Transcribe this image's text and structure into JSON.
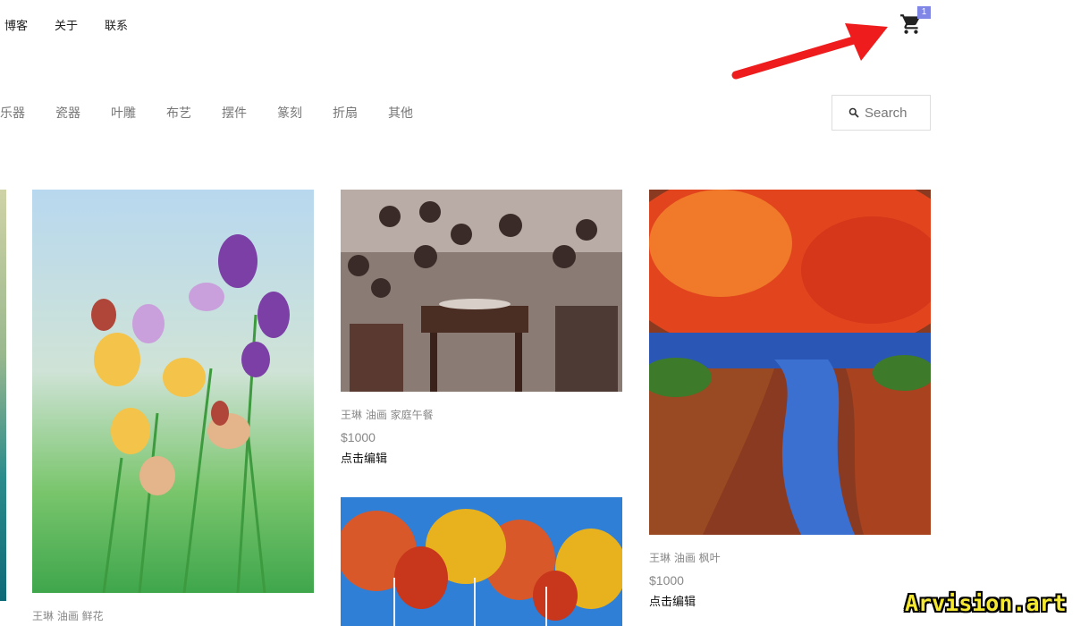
{
  "nav": {
    "links": [
      "博客",
      "关于",
      "联系"
    ]
  },
  "cart": {
    "icon": "cart-icon",
    "count": "1",
    "badge_color": "#7f86e6"
  },
  "categories": [
    "乐器",
    "瓷器",
    "叶雕",
    "布艺",
    "摆件",
    "篆刻",
    "折扇",
    "其他"
  ],
  "search": {
    "placeholder": "Search",
    "icon": "search-icon"
  },
  "products": [
    {
      "title": "王琳 油画 鲜花",
      "price": "",
      "edit": ""
    },
    {
      "title": "王琳 油画 家庭午餐",
      "price": "$1000",
      "edit": "点击编辑"
    },
    {
      "title": "",
      "price": "",
      "edit": ""
    },
    {
      "title": "王琳 油画 枫叶",
      "price": "$1000",
      "edit": "点击编辑"
    }
  ],
  "annotation": {
    "arrow_color": "#ee1c1c"
  },
  "watermark": "Arvision.art"
}
